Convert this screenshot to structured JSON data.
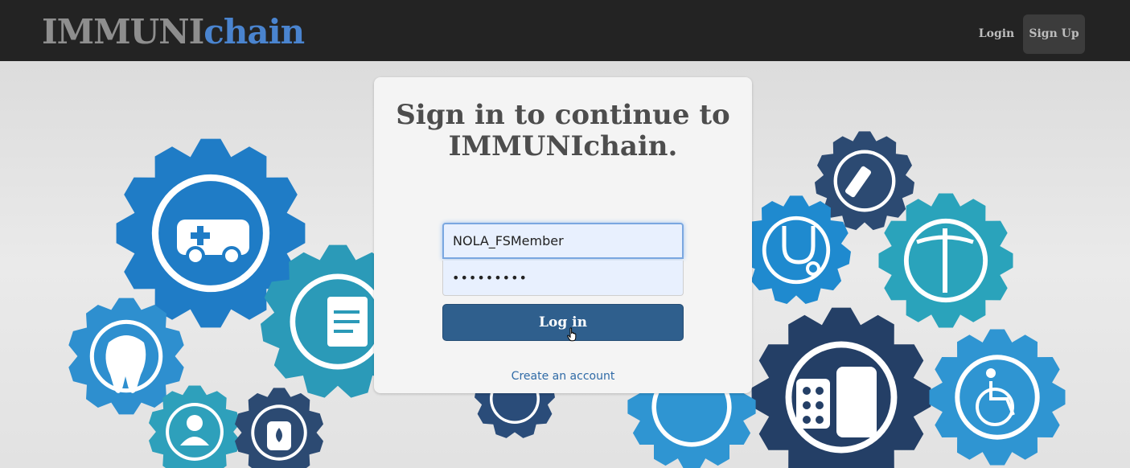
{
  "brand": {
    "part1": "IMMUNI",
    "part2": "chain"
  },
  "nav": {
    "login": "Login",
    "signup": "Sign Up"
  },
  "card": {
    "title_line1": "Sign in to continue to",
    "title_line2": "IMMUNIchain.",
    "username": {
      "value": "NOLA_FSMember"
    },
    "password": {
      "value": "•••••••••"
    },
    "login_button": "Log in",
    "create_account": "Create an account"
  },
  "background_icons": [
    "ambulance-icon",
    "document-edit-icon",
    "tooth-icon",
    "nurse-icon",
    "iv-bag-icon",
    "syringe-icon",
    "stethoscope-icon",
    "caduceus-icon",
    "pills-bottle-icon",
    "wheelchair-icon"
  ],
  "colors": {
    "navbar": "#232323",
    "brand_gray": "#8e8e8e",
    "brand_blue": "#4a84cf",
    "button": "#2f5f8d",
    "link": "#2f6aa6"
  }
}
